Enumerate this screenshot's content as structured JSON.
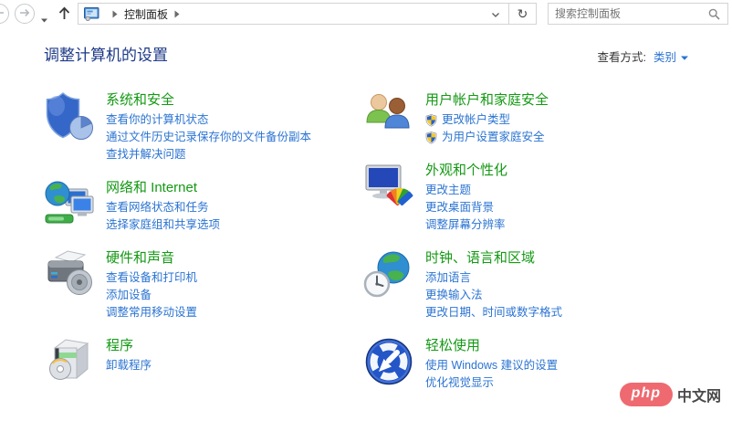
{
  "toolbar": {
    "icons": [
      "back-icon",
      "forward-icon",
      "dropdown-caret-icon",
      "up-icon",
      "control-panel-icon",
      "breadcrumb-chevron-icon",
      "address-caret-icon",
      "refresh-icon",
      "search-icon"
    ],
    "breadcrumb": {
      "root_label": "控制面板"
    },
    "refresh_glyph": "↻",
    "search": {
      "placeholder": "搜索控制面板",
      "value": ""
    }
  },
  "header": {
    "title": "调整计算机的设置",
    "view_by_label": "查看方式:",
    "view_by_value": "类别"
  },
  "categories": {
    "left": [
      {
        "id": "system-and-security",
        "icon": "shield-security-icon",
        "title": "系统和安全",
        "links": [
          {
            "id": "view-computer-status",
            "label": "查看你的计算机状态"
          },
          {
            "id": "file-history-backup",
            "label": "通过文件历史记录保存你的文件备份副本"
          },
          {
            "id": "find-fix-problems",
            "label": "查找并解决问题"
          }
        ]
      },
      {
        "id": "network-and-internet",
        "icon": "network-internet-icon",
        "title": "网络和 Internet",
        "links": [
          {
            "id": "view-network-status",
            "label": "查看网络状态和任务"
          },
          {
            "id": "homegroup-sharing-options",
            "label": "选择家庭组和共享选项"
          }
        ]
      },
      {
        "id": "hardware-and-sound",
        "icon": "hardware-sound-icon",
        "title": "硬件和声音",
        "links": [
          {
            "id": "view-devices-printers",
            "label": "查看设备和打印机"
          },
          {
            "id": "add-device",
            "label": "添加设备"
          },
          {
            "id": "adjust-mobility-settings",
            "label": "调整常用移动设置"
          }
        ]
      },
      {
        "id": "programs",
        "icon": "programs-icon",
        "title": "程序",
        "links": [
          {
            "id": "uninstall-program",
            "label": "卸载程序"
          }
        ]
      }
    ],
    "right": [
      {
        "id": "user-accounts-family-safety",
        "icon": "user-accounts-icon",
        "title": "用户帐户和家庭安全",
        "links": [
          {
            "id": "change-account-type",
            "label": "更改帐户类型",
            "shield": true
          },
          {
            "id": "set-family-safety",
            "label": "为用户设置家庭安全",
            "shield": true
          }
        ]
      },
      {
        "id": "appearance-personalization",
        "icon": "appearance-icon",
        "title": "外观和个性化",
        "links": [
          {
            "id": "change-theme",
            "label": "更改主题"
          },
          {
            "id": "change-desktop-background",
            "label": "更改桌面背景"
          },
          {
            "id": "adjust-screen-resolution",
            "label": "调整屏幕分辨率"
          }
        ]
      },
      {
        "id": "clock-language-region",
        "icon": "clock-region-icon",
        "title": "时钟、语言和区域",
        "links": [
          {
            "id": "add-language",
            "label": "添加语言"
          },
          {
            "id": "change-input-method",
            "label": "更换输入法"
          },
          {
            "id": "change-date-time-number-formats",
            "label": "更改日期、时间或数字格式"
          }
        ]
      },
      {
        "id": "ease-of-access",
        "icon": "ease-access-icon",
        "title": "轻松使用",
        "links": [
          {
            "id": "windows-suggested-settings",
            "label": "使用 Windows 建议的设置"
          },
          {
            "id": "optimize-visual-display",
            "label": "优化视觉显示"
          }
        ]
      }
    ]
  },
  "watermark": {
    "brand": "php",
    "text": "中文网"
  },
  "colors": {
    "category_title": "#149914",
    "link": "#2b74d2",
    "page_title": "#1e3a87",
    "badge": "#ee6a70"
  }
}
